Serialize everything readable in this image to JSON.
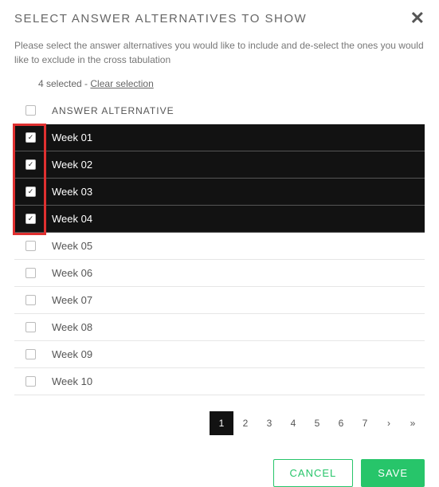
{
  "header": {
    "title": "SELECT ANSWER ALTERNATIVES TO SHOW",
    "close": "✕"
  },
  "description": "Please select the answer alternatives you would like to include and de-select the ones you would like to exclude in the cross tabulation",
  "selection": {
    "count_label": "4 selected -",
    "clear_label": "Clear selection"
  },
  "table": {
    "header_label": "ANSWER ALTERNATIVE",
    "rows": [
      {
        "label": "Week 01",
        "selected": true
      },
      {
        "label": "Week 02",
        "selected": true
      },
      {
        "label": "Week 03",
        "selected": true
      },
      {
        "label": "Week 04",
        "selected": true
      },
      {
        "label": "Week 05",
        "selected": false
      },
      {
        "label": "Week 06",
        "selected": false
      },
      {
        "label": "Week 07",
        "selected": false
      },
      {
        "label": "Week 08",
        "selected": false
      },
      {
        "label": "Week 09",
        "selected": false
      },
      {
        "label": "Week 10",
        "selected": false
      }
    ]
  },
  "pagination": {
    "pages": [
      "1",
      "2",
      "3",
      "4",
      "5",
      "6",
      "7"
    ],
    "next": "›",
    "last": "»",
    "active": "1"
  },
  "footer": {
    "cancel": "CANCEL",
    "save": "SAVE"
  }
}
